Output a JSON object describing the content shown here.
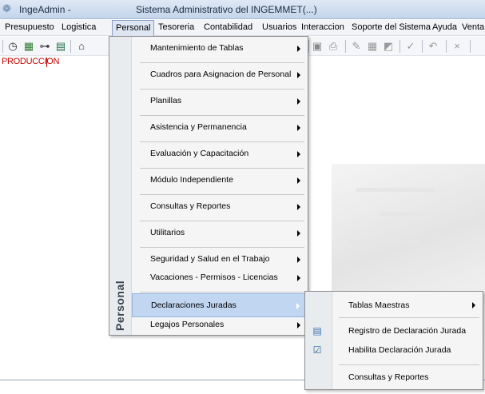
{
  "window": {
    "app_name": "IngeAdmin -",
    "title": "Sistema Administrativo del INGEMMET(...)"
  },
  "menubar": [
    {
      "label": "Presupuesto"
    },
    {
      "label": "Logistica"
    },
    {
      "label": "Personal"
    },
    {
      "label": "Tesoreria"
    },
    {
      "label": "Contabilidad"
    },
    {
      "label": "Usuarios"
    },
    {
      "label": "Interaccion"
    },
    {
      "label": "Soporte del Sistema"
    },
    {
      "label": "Ayuda"
    },
    {
      "label": "Venta"
    }
  ],
  "status": {
    "environment": "PRODUCCION"
  },
  "personal_menu": {
    "side_label": "Personal",
    "items": [
      {
        "label": "Mantenimiento de Tablas"
      },
      {
        "label": "Cuadros para Asignacion de Personal"
      },
      {
        "label": "Planillas"
      },
      {
        "label": "Asistencia y Permanencia"
      },
      {
        "label": "Evaluación y Capacitación"
      },
      {
        "label": "Módulo Independiente"
      },
      {
        "label": "Consultas y Reportes"
      },
      {
        "label": "Utilitarios"
      },
      {
        "label": "Seguridad y Salud en el Trabajo"
      },
      {
        "label": "Vacaciones - Permisos - Licencias"
      },
      {
        "label": "Declaraciones Juradas"
      },
      {
        "label": "Legajos Personales"
      }
    ]
  },
  "declaraciones_submenu": {
    "items": [
      {
        "label": "Tablas Maestras",
        "icon": "none"
      },
      {
        "label": "Registro de Declaración Jurada",
        "icon": "document-icon"
      },
      {
        "label": "Habilita Declaración Jurada",
        "icon": "checklist-icon"
      },
      {
        "label": "Consultas y Reportes",
        "icon": "none"
      }
    ]
  },
  "colors": {
    "highlight": "#c1d6f0",
    "environment_text": "#cc0000"
  }
}
